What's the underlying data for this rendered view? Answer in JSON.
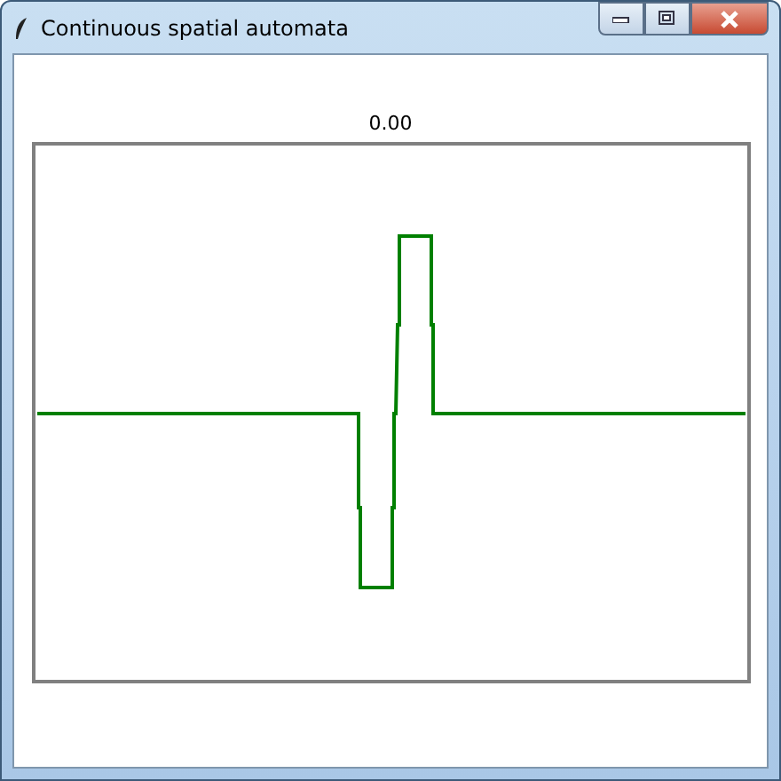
{
  "window": {
    "title": "Continuous spatial automata"
  },
  "plot": {
    "label": "0.00"
  }
}
